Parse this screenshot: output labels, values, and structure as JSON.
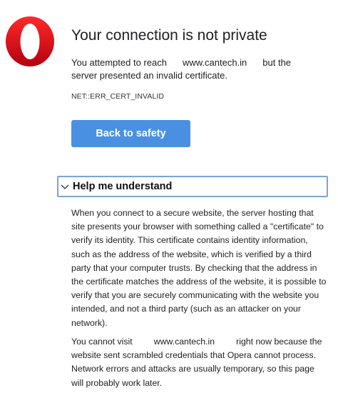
{
  "logo": {
    "icon": "opera-logo-icon",
    "color": "#e1191c"
  },
  "title": "Your connection is not private",
  "intro": {
    "before": "You attempted to reach",
    "domain": "www.cantech.in",
    "after": "but the server presented an invalid certificate."
  },
  "error_code": "NET::ERR_CERT_INVALID",
  "back_button": {
    "label": "Back to safety",
    "color": "#4a90e2"
  },
  "details": {
    "icon": "chevron-down-icon",
    "label": "Help me understand",
    "paragraph1": "When you connect to a secure website, the server hosting that site presents your browser with something called a \"certificate\" to verify its identity. This certificate contains identity information, such as the address of the website, which is verified by a third party that your computer trusts. By checking that the address in the certificate matches the address of the website, it is possible to verify that you are securely communicating with the website you intended, and not a third party (such as an attacker on your network).",
    "paragraph2": {
      "before": "You cannot visit",
      "domain": "www.cantech.in",
      "after": "right now because the website sent scrambled credentials that Opera cannot process. Network errors and attacks are usually temporary, so this page will probably work later."
    }
  }
}
